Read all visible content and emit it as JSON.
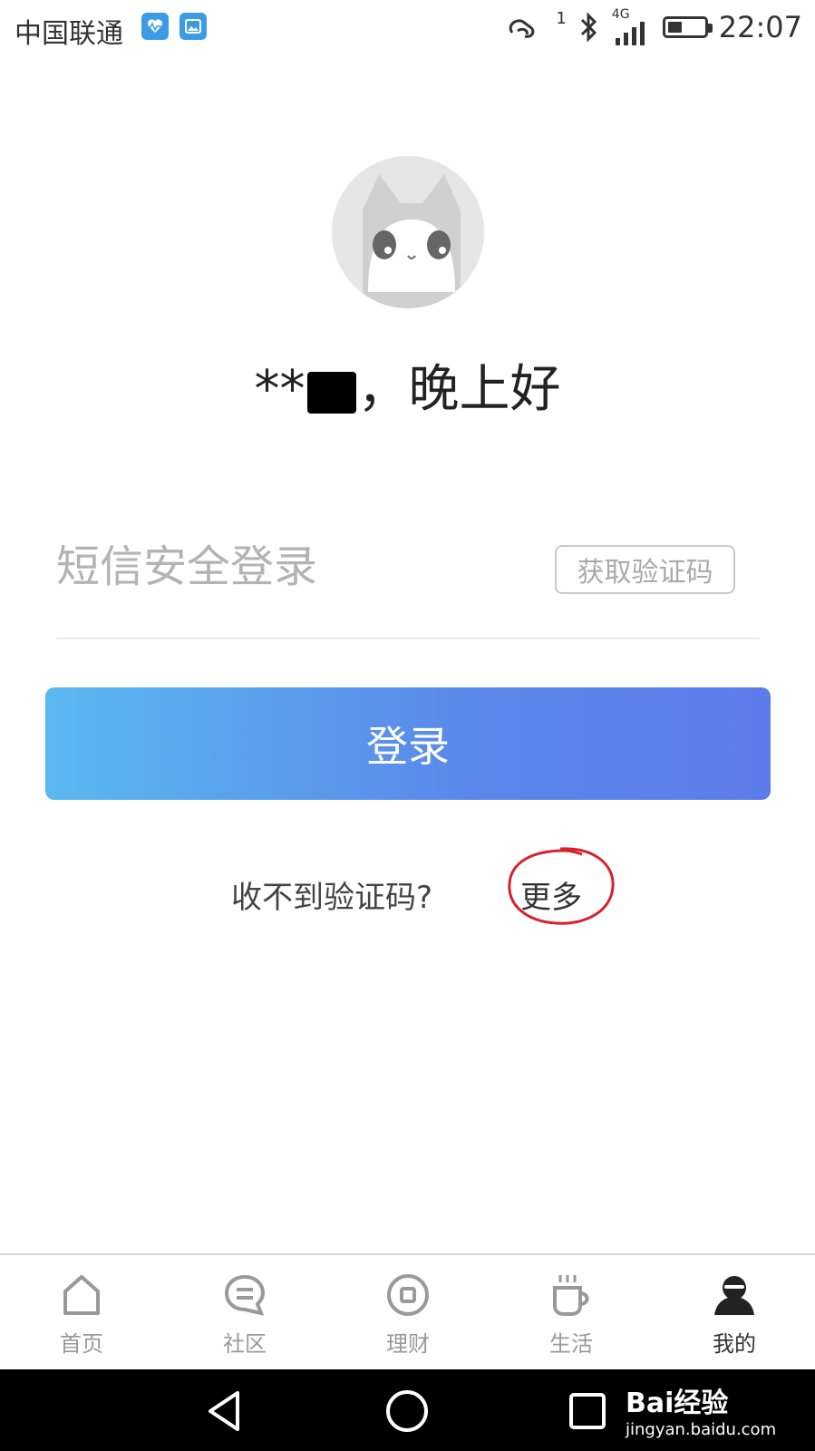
{
  "status_bar": {
    "carrier": "中国联通",
    "time": "22:07",
    "notification_icons": [
      "health-app-icon",
      "gallery-app-icon"
    ],
    "indicators": [
      "sync-icon",
      "bluetooth-icon",
      "signal-icon",
      "battery-icon"
    ],
    "network": "4G",
    "sim_index": "1",
    "battery_level": 0.4
  },
  "profile": {
    "greeting_prefix": "**",
    "greeting_suffix": "，晚上好"
  },
  "login": {
    "sms_placeholder": "短信安全登录",
    "sms_value": "",
    "get_code_label": "获取验证码",
    "login_label": "登录",
    "no_code_text": "收不到验证码?",
    "more_label": "更多"
  },
  "tabs": [
    {
      "label": "首页",
      "icon": "home-icon"
    },
    {
      "label": "社区",
      "icon": "chat-icon"
    },
    {
      "label": "理财",
      "icon": "finance-icon"
    },
    {
      "label": "生活",
      "icon": "cup-icon"
    },
    {
      "label": "我的",
      "icon": "user-icon",
      "active": true
    }
  ],
  "watermark": {
    "brand": "Bai经验",
    "url": "jingyan.baidu.com"
  },
  "colors": {
    "accent_start": "#5ab8f0",
    "accent_end": "#5d7ceb",
    "annotation": "#d8202a"
  }
}
